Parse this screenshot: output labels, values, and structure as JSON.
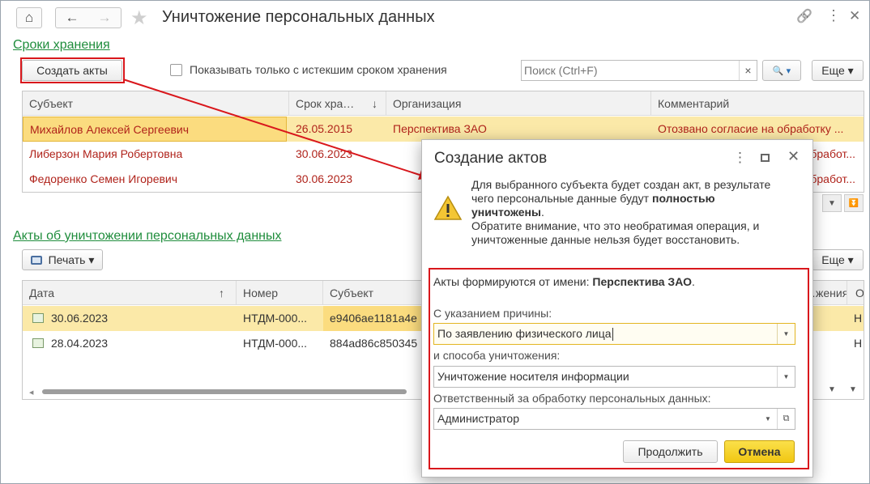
{
  "window": {
    "title": "Уничтожение персональных данных",
    "home_glyph": "⌂",
    "back_glyph": "←",
    "forward_glyph": "→",
    "star_glyph": "★",
    "link_glyph": "🔗",
    "more_glyph": "⋮",
    "close_glyph": "✕"
  },
  "storage": {
    "link": "Сроки хранения",
    "create_acts_button": "Создать акты",
    "checkbox_label": "Показывать только с истекшим сроком хранения",
    "search_placeholder": "Поиск (Ctrl+F)",
    "search_clear": "×",
    "search_button": "🔍 ▾",
    "more_button": "Еще ▾",
    "columns": [
      "Субъект",
      "Срок хра…",
      "Организация",
      "Комментарий"
    ],
    "sort_glyph": "↓",
    "rows": [
      {
        "subject": "Михайлов Алексей Сергеевич",
        "date": "26.05.2015",
        "org": "Перспектива ЗАО",
        "comment": "Отозвано согласие на обработку ..."
      },
      {
        "subject": "Либерзон Мария Робертовна",
        "date": "30.06.2023",
        "org": "",
        "comment": "обработ..."
      },
      {
        "subject": "Федоренко Семен Игоревич",
        "date": "30.06.2023",
        "org": "",
        "comment": "обработ..."
      }
    ]
  },
  "acts": {
    "link": "Акты об уничтожении персональных данных",
    "print_button": "Печать ▾",
    "more_button": "Еще ▾",
    "columns": [
      "Дата",
      "Номер",
      "Субъект",
      "…жения",
      "О"
    ],
    "sort_glyph": "↑",
    "rows": [
      {
        "date": "30.06.2023",
        "number": "НТДМ-000...",
        "subject": "e9406ae1181a4e",
        "last": "Н"
      },
      {
        "date": "28.04.2023",
        "number": "НТДМ-000...",
        "subject": "884ad86c850345",
        "last": "Н"
      }
    ]
  },
  "dialog": {
    "title": "Создание актов",
    "message_line1": "Для выбранного субъекта будет создан акт, в результате",
    "message_line2_a": "чего персональные данные будут ",
    "message_line2_b": "полностью",
    "message_line3_a": "уничтожены",
    "message_line3_b": ".",
    "message_line4": "Обратите внимание, что это необратимая операция, и",
    "message_line5": "уничтоженные данные нельзя будет восстановить.",
    "on_behalf_label": "Акты формируются от имени: ",
    "on_behalf_value": "Перспектива ЗАО",
    "on_behalf_end": ".",
    "reason_label": "С указанием причины:",
    "reason_value": "По заявлению физического лица",
    "method_label": "и способа уничтожения:",
    "method_value": "Уничтожение носителя информации",
    "responsible_label": "Ответственный за обработку персональных данных:",
    "responsible_value": "Администратор",
    "continue_button": "Продолжить",
    "cancel_button": "Отмена"
  },
  "colors": {
    "accent_red": "#d9171c",
    "link_green": "#1f8d3c",
    "selected_row": "#fbe9a8",
    "primary_button": "#f6d31d"
  }
}
